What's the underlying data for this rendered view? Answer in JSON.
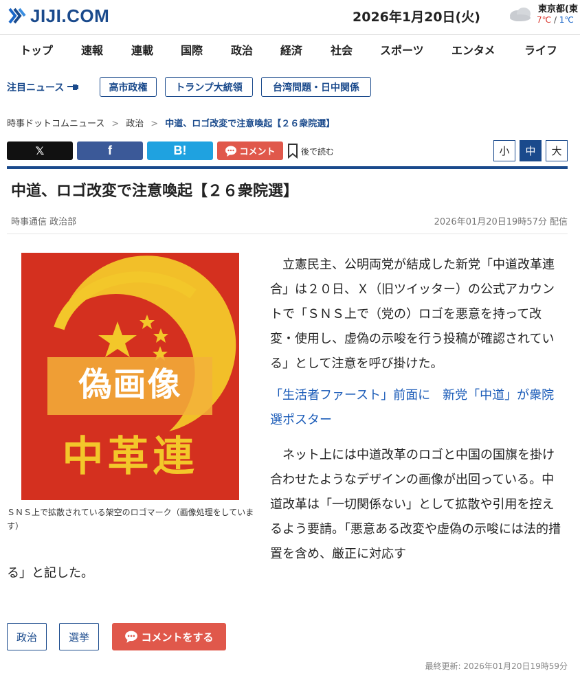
{
  "site": {
    "logo_text": "JIJI.COM"
  },
  "header": {
    "date": "2026年1月20日(火)",
    "weather": {
      "city": "東京都(東",
      "high": "7℃",
      "separator": " / ",
      "low": "1℃",
      "icon": "cloud-icon"
    }
  },
  "nav": {
    "items": [
      "トップ",
      "速報",
      "連載",
      "国際",
      "政治",
      "経済",
      "社会",
      "スポーツ",
      "エンタメ",
      "ライフ"
    ]
  },
  "featured": {
    "label": "注目ニュース",
    "tags": [
      "高市政権",
      "トランプ大統領",
      "台湾問題・日中関係"
    ]
  },
  "breadcrumb": {
    "items": [
      "時事ドットコムニュース",
      "政治",
      "中道、ロゴ改変で注意喚起【２６衆院選】"
    ],
    "separator": ">"
  },
  "share": {
    "x_label": "𝕏",
    "fb_label": "f",
    "hatena_label": "B!",
    "comment_label": "コメント",
    "bookmark_label": "後で読む"
  },
  "font_size": {
    "options": [
      "小",
      "中",
      "大"
    ],
    "selected": "中"
  },
  "article": {
    "headline": "中道、ロゴ改変で注意喚起【２６衆院選】",
    "byline": "時事通信 政治部",
    "published": "2026年01月20日19時57分 配信",
    "photo": {
      "overlay_top": "偽画像",
      "overlay_bottom": "中革連"
    },
    "caption": "ＳＮＳ上で拡散されている架空のロゴマーク（画像処理をしています）",
    "paragraph1": "立憲民主、公明両党が結成した新党「中道改革連合」は２０日、Ｘ（旧ツイッター）の公式アカウントで「ＳＮＳ上で（党の）ロゴを悪意を持って改変・使用し、虚偽の示唆を行う投稿が確認されている」として注意を呼び掛けた。",
    "related_link": "「生活者ファースト」前面に　新党「中道」が衆院選ポスター",
    "paragraph2": "ネット上には中道改革のロゴと中国の国旗を掛け合わせたようなデザインの画像が出回っている。中道改革は「一切関係ない」として拡散や引用を控えるよう要請。「悪意ある改変や虚偽の示唆には法的措置を含め、厳正に対応す",
    "paragraph2_tail": "る」と記した。"
  },
  "footer": {
    "tags": [
      "政治",
      "選挙"
    ],
    "comment_button": "コメントをする",
    "updated": "最終更新: 2026年01月20日19時59分"
  },
  "colors": {
    "brand": "#1a4a8c",
    "comment": "#e0584b",
    "link": "#1a5bb8",
    "photo_red": "#d4301f",
    "photo_yellow": "#f3c72a"
  }
}
